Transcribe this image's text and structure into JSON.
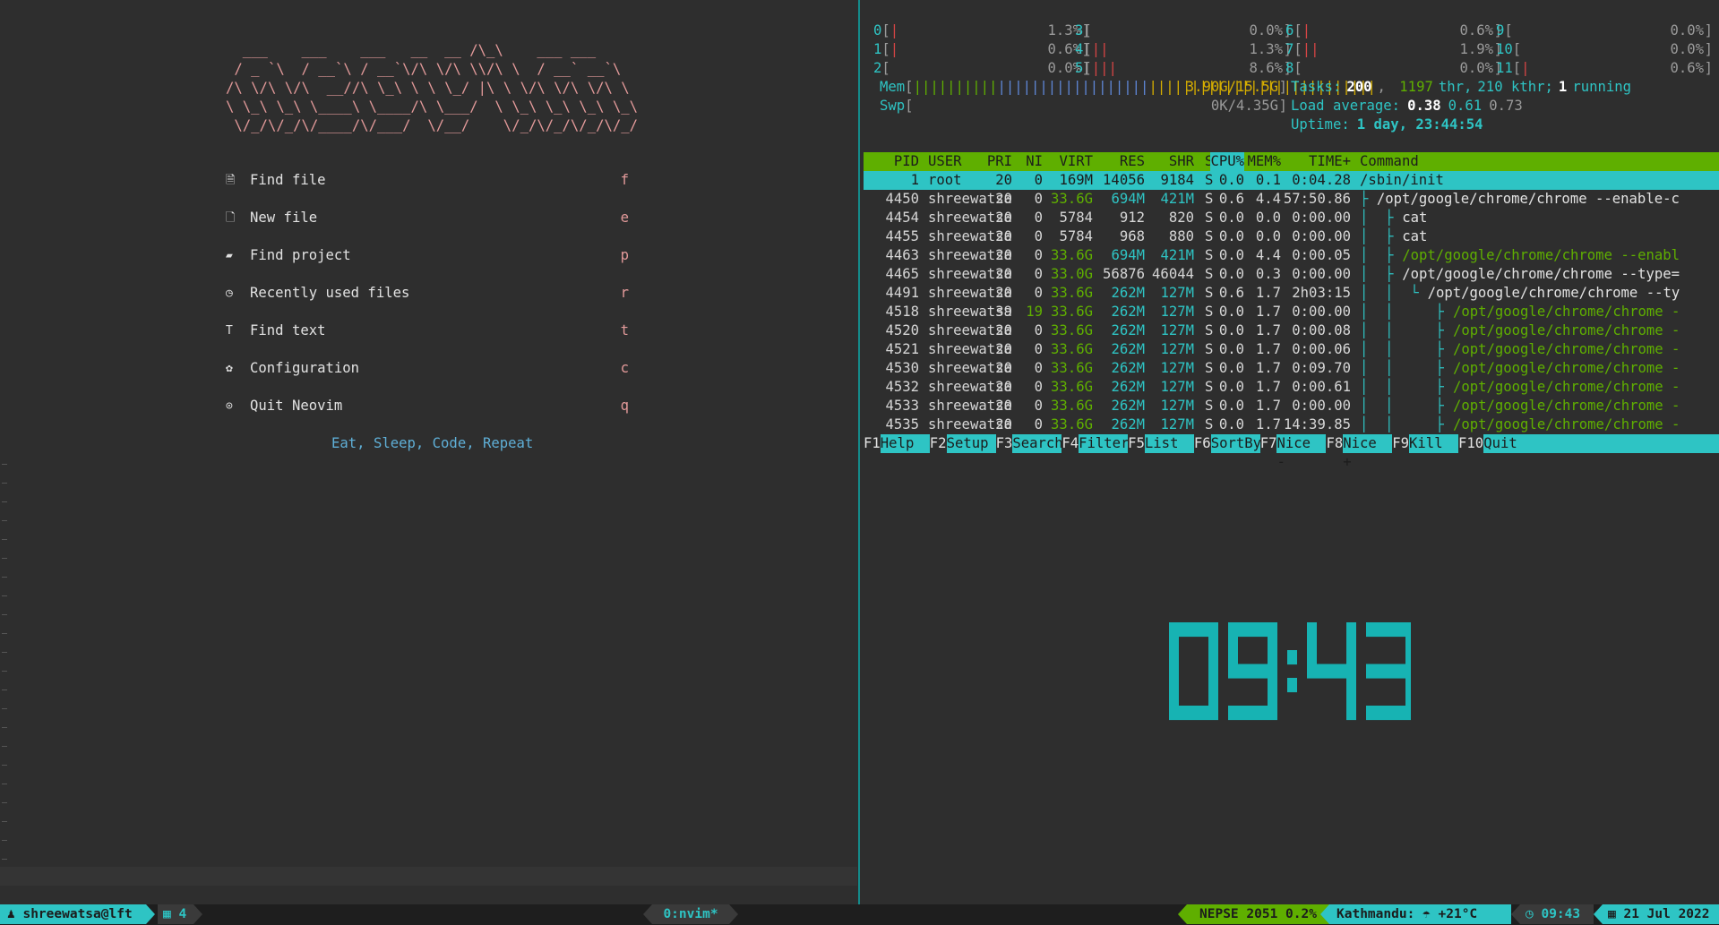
{
  "nvim": {
    "banner": "  ___    ___    ___   __  __ /\\_\\    ___ ___\n / _ `\\  / __`\\ / __`\\/\\ \\/\\ \\\\/\\ \\  / __` __`\\\n/\\ \\/\\ \\/\\  __//\\ \\_\\ \\ \\ \\_/ |\\ \\ \\/\\ \\/\\ \\/\\ \\\n\\ \\_\\ \\_\\ \\____\\ \\____/\\ \\___/  \\ \\_\\ \\_\\ \\_\\ \\_\\\n \\/_/\\/_/\\/____/\\/___/  \\/__/    \\/_/\\/_/\\/_/\\/_/",
    "menu": [
      {
        "icon": "find-file-icon",
        "glyph": "🗎",
        "label": "Find file",
        "key": "f"
      },
      {
        "icon": "new-file-icon",
        "glyph": "🗋",
        "label": "New file",
        "key": "e"
      },
      {
        "icon": "folder-icon",
        "glyph": "▰",
        "label": "Find project",
        "key": "p"
      },
      {
        "icon": "history-icon",
        "glyph": "◷",
        "label": "Recently used files",
        "key": "r"
      },
      {
        "icon": "text-icon",
        "glyph": "T",
        "label": "Find text",
        "key": "t"
      },
      {
        "icon": "gear-icon",
        "glyph": "✿",
        "label": "Configuration",
        "key": "c"
      },
      {
        "icon": "power-icon",
        "glyph": "⊙",
        "label": "Quit Neovim",
        "key": "q"
      }
    ],
    "tagline": "Eat, Sleep, Code, Repeat"
  },
  "htop": {
    "cpus": [
      {
        "id": "0",
        "bars": "|",
        "pct": "1.3%"
      },
      {
        "id": "1",
        "bars": "|",
        "pct": "0.6%"
      },
      {
        "id": "2",
        "bars": "",
        "pct": "0.0%"
      },
      {
        "id": "3",
        "bars": "",
        "pct": "0.0%"
      },
      {
        "id": "4",
        "bars": "||",
        "pct": "1.3%"
      },
      {
        "id": "5",
        "bars": "|||",
        "pct": "8.6%"
      },
      {
        "id": "6",
        "bars": "|",
        "pct": "0.6%"
      },
      {
        "id": "7",
        "bars": "||",
        "pct": "1.9%"
      },
      {
        "id": "8",
        "bars": "",
        "pct": "0.0%"
      },
      {
        "id": "9",
        "bars": "",
        "pct": "0.0%"
      },
      {
        "id": "10",
        "bars": "",
        "pct": "0.0%"
      },
      {
        "id": "11",
        "bars": "|",
        "pct": "0.6%"
      }
    ],
    "mem": {
      "label": "Mem",
      "value": "3.90G/15.5G"
    },
    "swp": {
      "label": "Swp",
      "value": "0K/4.35G"
    },
    "tasks": {
      "label": "Tasks:",
      "count": "200",
      "thr": "1197",
      "thr_label": "thr,",
      "kthr": "210 kthr;",
      "running": "1",
      "running_label": "running"
    },
    "load": {
      "label": "Load average:",
      "v1": "0.38",
      "v2": "0.61",
      "v3": "0.73"
    },
    "uptime": {
      "label": "Uptime:",
      "value": "1 day, 23:44:54"
    },
    "columns": [
      "PID",
      "USER",
      "PRI",
      "NI",
      "VIRT",
      "RES",
      "SHR",
      "S",
      "CPU%",
      "MEM%",
      "TIME+",
      "Command"
    ],
    "rows": [
      {
        "pid": "1",
        "user": "root",
        "pri": "20",
        "ni": "0",
        "virt": "169M",
        "res": "14056",
        "shr": "9184",
        "s": "S",
        "cpu": "0.0",
        "mem": "0.1",
        "time": "0:04.28",
        "tree": "",
        "cmd": "/sbin/init",
        "sel": true
      },
      {
        "pid": "4450",
        "user": "shreewatsa",
        "pri": "20",
        "ni": "0",
        "virt": "33.6G",
        "res": "694M",
        "shr": "421M",
        "s": "S",
        "cpu": "0.6",
        "mem": "4.4",
        "time": "57:50.86",
        "tree": "├ ",
        "cmd": "/opt/google/chrome/chrome --enable-c"
      },
      {
        "pid": "4454",
        "user": "shreewatsa",
        "pri": "20",
        "ni": "0",
        "virt": "5784",
        "res": "912",
        "shr": "820",
        "s": "S",
        "cpu": "0.0",
        "mem": "0.0",
        "time": "0:00.00",
        "tree": "│  ├ ",
        "cmd": "cat"
      },
      {
        "pid": "4455",
        "user": "shreewatsa",
        "pri": "20",
        "ni": "0",
        "virt": "5784",
        "res": "968",
        "shr": "880",
        "s": "S",
        "cpu": "0.0",
        "mem": "0.0",
        "time": "0:00.00",
        "tree": "│  ├ ",
        "cmd": "cat"
      },
      {
        "pid": "4463",
        "user": "shreewatsa",
        "pri": "20",
        "ni": "0",
        "virt": "33.6G",
        "res": "694M",
        "shr": "421M",
        "s": "S",
        "cpu": "0.0",
        "mem": "4.4",
        "time": "0:00.05",
        "tree": "│  ├ ",
        "cmd": "/opt/google/chrome/chrome --enabl",
        "thr": true
      },
      {
        "pid": "4465",
        "user": "shreewatsa",
        "pri": "20",
        "ni": "0",
        "virt": "33.0G",
        "res": "56876",
        "shr": "46044",
        "s": "S",
        "cpu": "0.0",
        "mem": "0.3",
        "time": "0:00.00",
        "tree": "│  ├ ",
        "cmd": "/opt/google/chrome/chrome --type="
      },
      {
        "pid": "4491",
        "user": "shreewatsa",
        "pri": "20",
        "ni": "0",
        "virt": "33.6G",
        "res": "262M",
        "shr": "127M",
        "s": "S",
        "cpu": "0.6",
        "mem": "1.7",
        "time": "2h03:15",
        "tree": "│  │  └ ",
        "cmd": "/opt/google/chrome/chrome --ty"
      },
      {
        "pid": "4518",
        "user": "shreewatsa",
        "pri": "39",
        "ni": "19",
        "virt": "33.6G",
        "res": "262M",
        "shr": "127M",
        "s": "S",
        "cpu": "0.0",
        "mem": "1.7",
        "time": "0:00.00",
        "tree": "│  │     ├ ",
        "cmd": "/opt/google/chrome/chrome -",
        "thr": true
      },
      {
        "pid": "4520",
        "user": "shreewatsa",
        "pri": "20",
        "ni": "0",
        "virt": "33.6G",
        "res": "262M",
        "shr": "127M",
        "s": "S",
        "cpu": "0.0",
        "mem": "1.7",
        "time": "0:00.08",
        "tree": "│  │     ├ ",
        "cmd": "/opt/google/chrome/chrome -",
        "thr": true
      },
      {
        "pid": "4521",
        "user": "shreewatsa",
        "pri": "20",
        "ni": "0",
        "virt": "33.6G",
        "res": "262M",
        "shr": "127M",
        "s": "S",
        "cpu": "0.0",
        "mem": "1.7",
        "time": "0:00.06",
        "tree": "│  │     ├ ",
        "cmd": "/opt/google/chrome/chrome -",
        "thr": true
      },
      {
        "pid": "4530",
        "user": "shreewatsa",
        "pri": "20",
        "ni": "0",
        "virt": "33.6G",
        "res": "262M",
        "shr": "127M",
        "s": "S",
        "cpu": "0.0",
        "mem": "1.7",
        "time": "0:09.70",
        "tree": "│  │     ├ ",
        "cmd": "/opt/google/chrome/chrome -",
        "thr": true
      },
      {
        "pid": "4532",
        "user": "shreewatsa",
        "pri": "20",
        "ni": "0",
        "virt": "33.6G",
        "res": "262M",
        "shr": "127M",
        "s": "S",
        "cpu": "0.0",
        "mem": "1.7",
        "time": "0:00.61",
        "tree": "│  │     ├ ",
        "cmd": "/opt/google/chrome/chrome -",
        "thr": true
      },
      {
        "pid": "4533",
        "user": "shreewatsa",
        "pri": "20",
        "ni": "0",
        "virt": "33.6G",
        "res": "262M",
        "shr": "127M",
        "s": "S",
        "cpu": "0.0",
        "mem": "1.7",
        "time": "0:00.00",
        "tree": "│  │     ├ ",
        "cmd": "/opt/google/chrome/chrome -",
        "thr": true
      },
      {
        "pid": "4535",
        "user": "shreewatsa",
        "pri": "20",
        "ni": "0",
        "virt": "33.6G",
        "res": "262M",
        "shr": "127M",
        "s": "S",
        "cpu": "0.0",
        "mem": "1.7",
        "time": "14:39.85",
        "tree": "│  │     ├ ",
        "cmd": "/opt/google/chrome/chrome -",
        "thr": true
      }
    ],
    "fkeys": [
      {
        "k": "F1",
        "l": "Help"
      },
      {
        "k": "F2",
        "l": "Setup"
      },
      {
        "k": "F3",
        "l": "Search"
      },
      {
        "k": "F4",
        "l": "Filter"
      },
      {
        "k": "F5",
        "l": "List"
      },
      {
        "k": "F6",
        "l": "SortBy"
      },
      {
        "k": "F7",
        "l": "Nice -"
      },
      {
        "k": "F8",
        "l": "Nice +"
      },
      {
        "k": "F9",
        "l": "Kill"
      },
      {
        "k": "F10",
        "l": "Quit"
      }
    ]
  },
  "clock": {
    "time": "09:43",
    "color": "#17b3b3"
  },
  "tmux": {
    "user": "shreewatsa@lft",
    "panes": "4",
    "window": "0:nvim*",
    "nepse": "NEPSE 2051 0.2%",
    "weather_city": "Kathmandu:",
    "weather_temp": "+21°C",
    "time": "09:43",
    "date": "21 Jul 2022"
  },
  "colors": {
    "accent": "#2ec4c4",
    "green": "#5faf00",
    "banner": "#e39a9a"
  }
}
